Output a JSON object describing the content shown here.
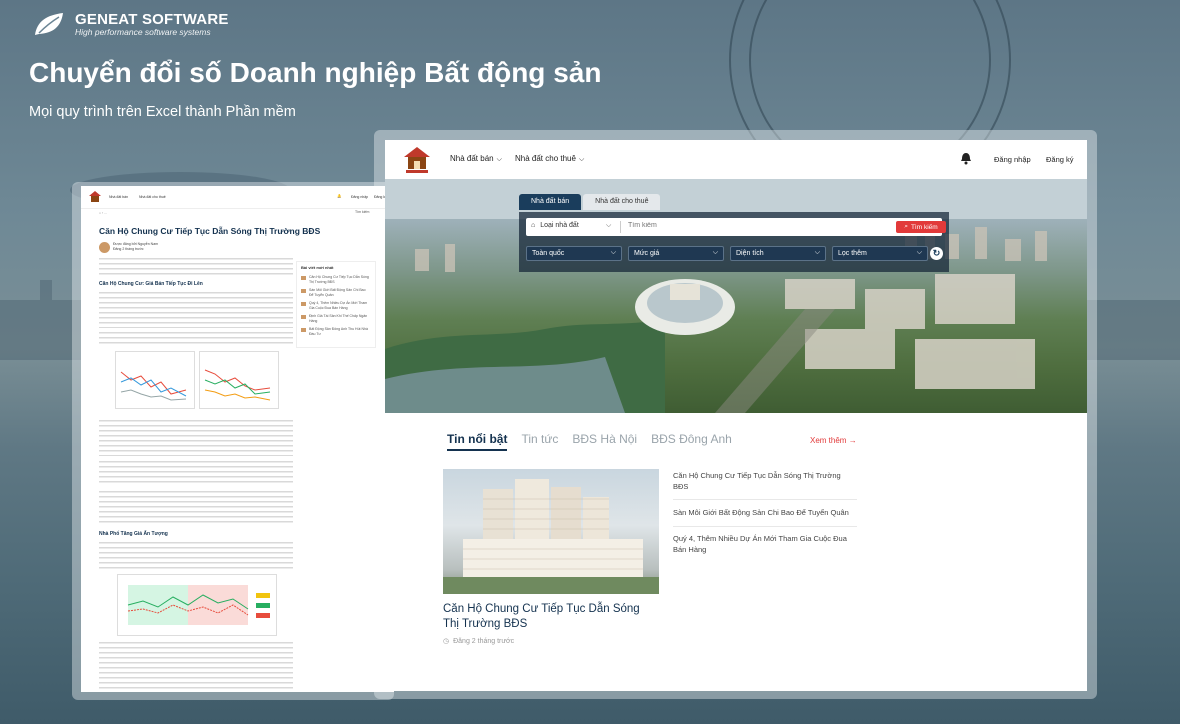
{
  "brand": {
    "name": "GENEAT SOFTWARE",
    "tagline": "High performance software systems",
    "logo_icon": "leaf-logo-icon"
  },
  "hero": {
    "title": "Chuyển đổi số Doanh nghiệp Bất động sản",
    "subtitle": "Mọi quy trình trên Excel thành Phần mềm"
  },
  "colors": {
    "accent": "#e23a3a",
    "navy": "#14324f"
  },
  "site": {
    "nav": {
      "menu_sale": "Nhà đất bán",
      "menu_rent": "Nhà đất cho thuê",
      "login": "Đăng nhập",
      "signup": "Đăng ký"
    },
    "search": {
      "tabs": [
        "Nhà đất bán",
        "Nhà đất cho thuê"
      ],
      "type_label": "Loại nhà đất",
      "placeholder": "Tìm kiếm",
      "button": "Tìm kiếm",
      "filters": [
        "Toàn quốc",
        "Mức giá",
        "Diện tích",
        "Lọc thêm"
      ]
    },
    "news": {
      "tabs": [
        "Tin nổi bật",
        "Tin tức",
        "BĐS Hà Nội",
        "BĐS Đông Anh"
      ],
      "more": "Xem thêm",
      "featured_title": "Căn Hộ Chung Cư Tiếp Tục Dẫn Sóng Thị Trường BĐS",
      "featured_time": "Đăng 2 tháng trước",
      "side": [
        "Căn Hộ Chung Cư Tiếp Tục Dẫn Sóng Thị Trường BĐS",
        "Sàn Môi Giới Bất Động Sản Chi Bao Để Tuyển Quân",
        "Quý 4, Thêm Nhiều Dự Án Mới Tham Gia Cuộc Đua Bán Hàng"
      ]
    }
  },
  "article": {
    "nav_sale": "Nhà đất bán",
    "nav_rent": "Nhà đất cho thuê",
    "login": "Đăng nhập",
    "signup": "Đăng ký",
    "search": "Tìm kiếm",
    "title": "Căn Hộ Chung Cư Tiếp Tục Dẫn Sóng Thị Trường BĐS",
    "author": "Được đăng bởi Nguyễn Nam",
    "posted": "Đăng 2 tháng trước",
    "h1": "Căn Hộ Chung Cư: Giá Bán Tiếp Tục Đi Lên",
    "h2": "Nhà Phố Tăng Giá Ấn Tượng",
    "side_title": "Bài viết mới nhất",
    "side_items": [
      "Căn Hộ Chung Cư Tiếp Tục Dẫn Sóng Thị Trường BĐS",
      "Sàn Môi Giới Bất Động Sản Chi Bao Để Tuyển Quân",
      "Quý 4, Thêm Nhiều Dự Án Mới Tham Gia Cuộc Đua Bán Hàng",
      "Định Giá Tài Sản Khi Thế Chấp Ngân Hàng",
      "Bất Động Sản Đông Anh Thu Hút Nhà Đầu Tư"
    ]
  }
}
